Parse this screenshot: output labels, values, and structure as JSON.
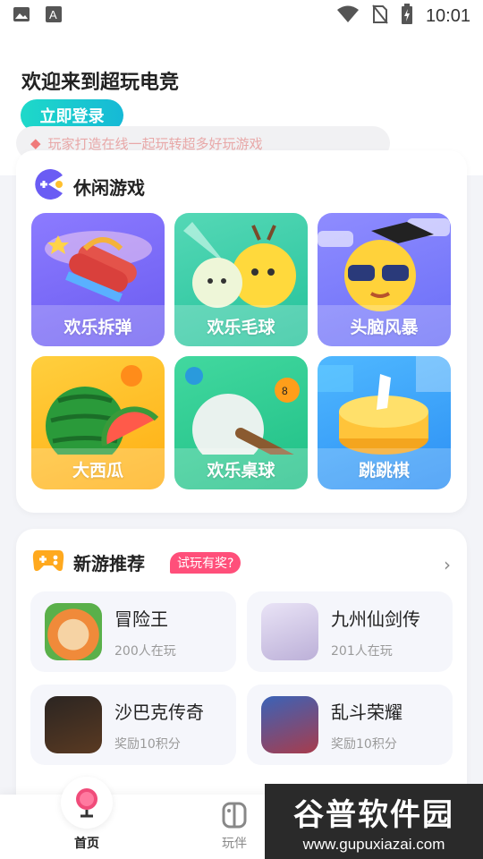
{
  "status_bar": {
    "time": "10:01"
  },
  "header": {
    "welcome": "欢迎来到超玩电竞",
    "login_button": "立即登录",
    "ticker_text": "玩家打造在线一起玩转超多好玩游戏"
  },
  "casual_games": {
    "title": "休闲游戏",
    "games": [
      {
        "name": "欢乐拆弹"
      },
      {
        "name": "欢乐毛球"
      },
      {
        "name": "头脑风暴"
      },
      {
        "name": "大西瓜"
      },
      {
        "name": "欢乐桌球"
      },
      {
        "name": "跳跳棋"
      }
    ]
  },
  "new_games": {
    "title": "新游推荐",
    "tag": "试玩有奖?",
    "items": [
      {
        "name": "冒险王",
        "sub": "200人在玩"
      },
      {
        "name": "九州仙剑传",
        "sub": "201人在玩"
      },
      {
        "name": "沙巴克传奇",
        "sub": "奖励10积分"
      },
      {
        "name": "乱斗荣耀",
        "sub": "奖励10积分"
      }
    ]
  },
  "nav": {
    "home": "首页",
    "play": "玩伴"
  },
  "watermark": {
    "title": "谷普软件园",
    "url": "www.gupuxiazai.com"
  }
}
